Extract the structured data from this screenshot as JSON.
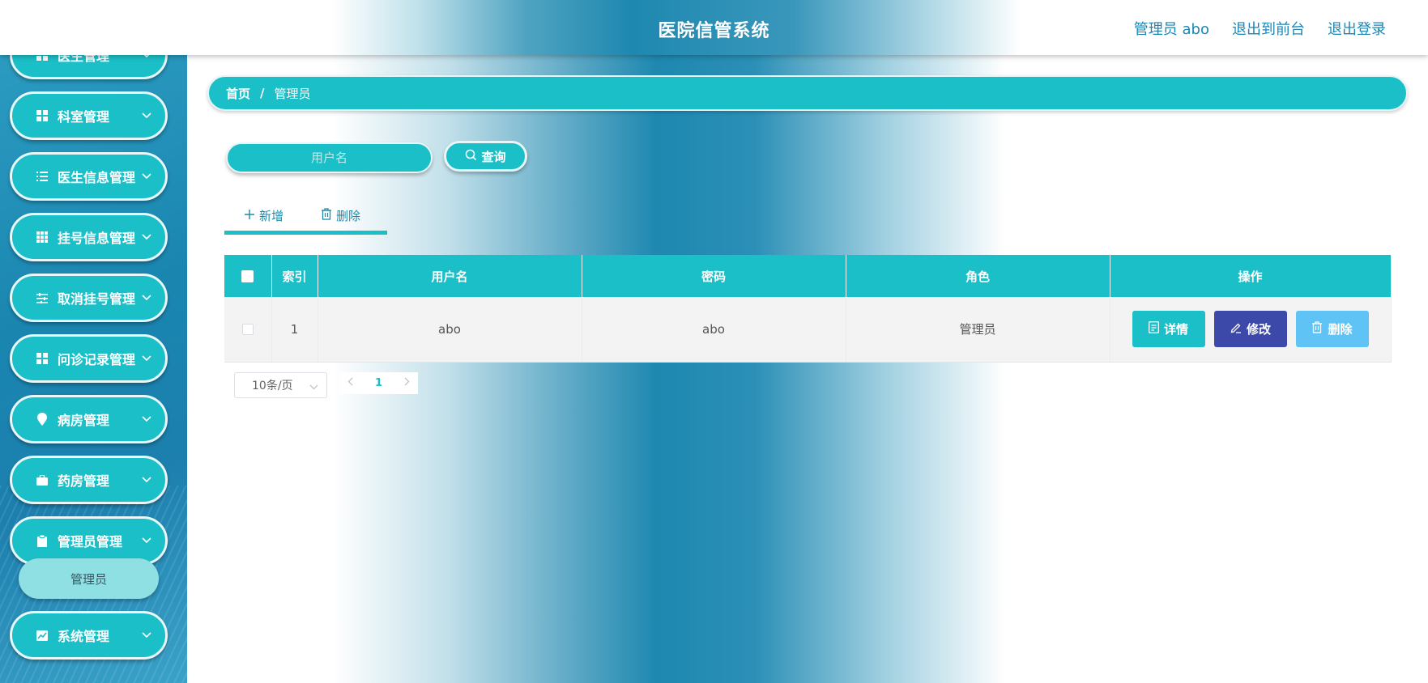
{
  "header": {
    "title": "医院信管系统",
    "user_label": "管理员 abo",
    "front_label": "退出到前台",
    "logout_label": "退出登录"
  },
  "sidebar": {
    "items": [
      {
        "label": "医生管理",
        "icon": "grid-icon"
      },
      {
        "label": "科室管理",
        "icon": "grid-icon"
      },
      {
        "label": "医生信息管理",
        "icon": "list-icon"
      },
      {
        "label": "挂号信息管理",
        "icon": "apps-icon"
      },
      {
        "label": "取消挂号管理",
        "icon": "sliders-icon"
      },
      {
        "label": "问诊记录管理",
        "icon": "grid-icon"
      },
      {
        "label": "病房管理",
        "icon": "location-icon"
      },
      {
        "label": "药房管理",
        "icon": "briefcase-icon"
      },
      {
        "label": "管理员管理",
        "icon": "clipboard-icon"
      },
      {
        "label": "系统管理",
        "icon": "chart-icon"
      }
    ],
    "submenu_active": "管理员"
  },
  "breadcrumb": {
    "home": "首页",
    "separator": "/",
    "current": "管理员"
  },
  "search": {
    "placeholder": "用户名",
    "button_label": "查询"
  },
  "actions": {
    "add_label": "新增",
    "delete_label": "删除"
  },
  "table": {
    "headers": [
      "索引",
      "用户名",
      "密码",
      "角色",
      "操作"
    ],
    "rows": [
      {
        "index": "1",
        "username": "abo",
        "password": "abo",
        "role": "管理员"
      }
    ],
    "ops": {
      "detail": "详情",
      "edit": "修改",
      "delete": "删除"
    }
  },
  "pagination": {
    "page_size": "10条/页",
    "current_page": "1"
  },
  "colors": {
    "accent": "#1bbfc7",
    "edit_button": "#3d49a8",
    "delete_button": "#5fc4f5",
    "header_link": "#1b87b5"
  }
}
